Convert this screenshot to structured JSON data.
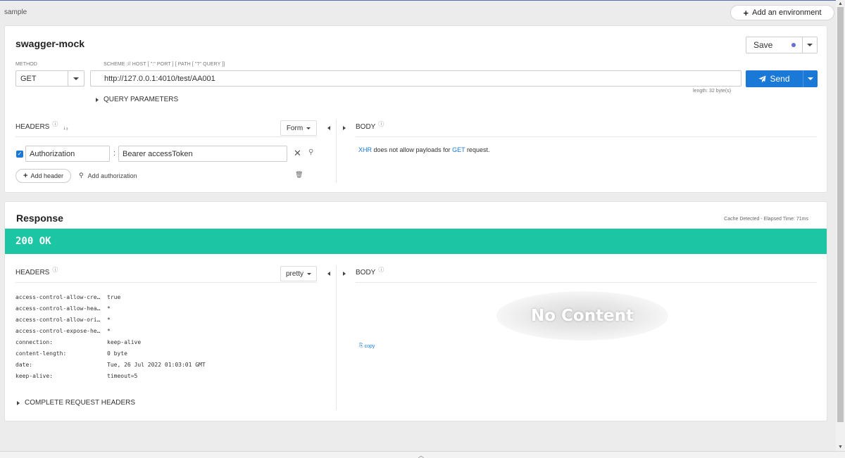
{
  "environment": {
    "name": "sample",
    "add_env_label": "Add an environment"
  },
  "request": {
    "title": "swagger-mock",
    "save_label": "Save",
    "method_label": "METHOD",
    "method_value": "GET",
    "url_label": "SCHEME :// HOST [ \":\" PORT ] [ PATH [ \"?\" QUERY ]]",
    "url_value": "http://127.0.0.1:4010/test/AA001",
    "send_label": "Send",
    "length_note": "length: 32 byte(s)",
    "query_params_label": "QUERY PARAMETERS",
    "headers_label": "HEADERS",
    "headers_mode": "Form",
    "body_label": "BODY",
    "header_rows": [
      {
        "checked": true,
        "key": "Authorization",
        "value": "Bearer accessToken"
      }
    ],
    "add_header_label": "Add header",
    "add_auth_label": "Add authorization",
    "body_note": {
      "xhr": "XHR",
      "middle": " does not allow payloads for ",
      "method": "GET",
      "end": " request."
    }
  },
  "response": {
    "title": "Response",
    "elapsed": "Cache Detected - Elapsed Time: 71ms",
    "status": "200 OK",
    "headers_label": "HEADERS",
    "headers_mode": "pretty",
    "body_label": "BODY",
    "headers": [
      {
        "key": "access-control-allow-cre…",
        "value": "true"
      },
      {
        "key": "access-control-allow-hea…",
        "value": "*"
      },
      {
        "key": "access-control-allow-ori…",
        "value": "*"
      },
      {
        "key": "access-control-expose-he…",
        "value": "*"
      },
      {
        "key": "connection:",
        "value": "keep-alive"
      },
      {
        "key": "content-length:",
        "value": "0 byte"
      },
      {
        "key": "date:",
        "value": "Tue, 26 Jul 2022 01:03:01 GMT"
      },
      {
        "key": "keep-alive:",
        "value": "timeout=5"
      }
    ],
    "complete_headers_label": "COMPLETE REQUEST HEADERS",
    "no_content_label": "No Content",
    "copy_label": "copy"
  },
  "colors": {
    "accent": "#1a78d6",
    "status_ok": "#1cc5a4",
    "save_dot": "#6470d6"
  },
  "icons": [
    "plus-icon",
    "send-icon",
    "sort-icon",
    "help-icon",
    "close-icon",
    "key-icon",
    "trash-icon",
    "copy-icon",
    "caret-down-icon",
    "triangle-right-icon",
    "triangle-left-icon",
    "chevron-up-icon"
  ]
}
